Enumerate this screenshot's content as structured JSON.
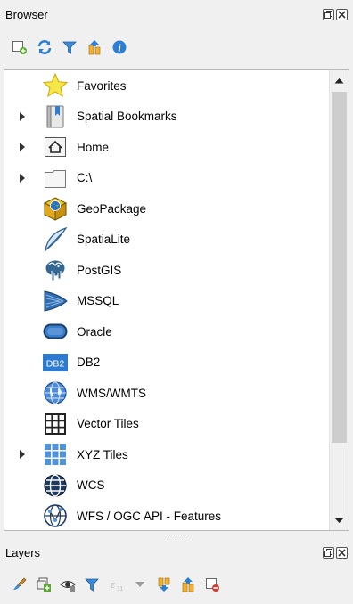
{
  "browser": {
    "title": "Browser",
    "toolbar": [
      {
        "icon": "add-selected-layers-icon"
      },
      {
        "icon": "refresh-icon"
      },
      {
        "icon": "filter-icon"
      },
      {
        "icon": "collapse-all-icon"
      },
      {
        "icon": "properties-info-icon"
      }
    ],
    "items": [
      {
        "label": "Favorites",
        "icon": "star-icon",
        "expandable": false
      },
      {
        "label": "Spatial Bookmarks",
        "icon": "bookmarks-icon",
        "expandable": true
      },
      {
        "label": "Home",
        "icon": "home-icon",
        "expandable": true
      },
      {
        "label": "C:\\",
        "icon": "folder-icon",
        "expandable": true
      },
      {
        "label": "GeoPackage",
        "icon": "geopackage-icon",
        "expandable": false
      },
      {
        "label": "SpatiaLite",
        "icon": "spatialite-feather-icon",
        "expandable": false
      },
      {
        "label": "PostGIS",
        "icon": "postgis-elephant-icon",
        "expandable": false
      },
      {
        "label": "MSSQL",
        "icon": "mssql-icon",
        "expandable": false
      },
      {
        "label": "Oracle",
        "icon": "oracle-icon",
        "expandable": false
      },
      {
        "label": "DB2",
        "icon": "db2-icon",
        "expandable": false
      },
      {
        "label": "WMS/WMTS",
        "icon": "globe-icon",
        "expandable": false
      },
      {
        "label": "Vector Tiles",
        "icon": "vector-tiles-grid-icon",
        "expandable": false
      },
      {
        "label": "XYZ Tiles",
        "icon": "xyz-tiles-icon",
        "expandable": true
      },
      {
        "label": "WCS",
        "icon": "wcs-globe-icon",
        "expandable": false
      },
      {
        "label": "WFS / OGC API - Features",
        "icon": "wfs-globe-icon",
        "expandable": false
      }
    ]
  },
  "layers": {
    "title": "Layers",
    "toolbar": [
      {
        "icon": "style-brush-icon"
      },
      {
        "icon": "add-group-icon"
      },
      {
        "icon": "visibility-eye-icon"
      },
      {
        "icon": "filter-icon"
      },
      {
        "icon": "filter-expression-icon"
      },
      {
        "icon": "dropdown-arrow-icon"
      },
      {
        "icon": "expand-all-icon"
      },
      {
        "icon": "collapse-all-icon"
      },
      {
        "icon": "remove-layer-icon"
      }
    ]
  },
  "colors": {
    "accent_blue": "#2a7fd4",
    "star_yellow": "#f5e33a",
    "panel_bg": "#f0f0f0"
  }
}
